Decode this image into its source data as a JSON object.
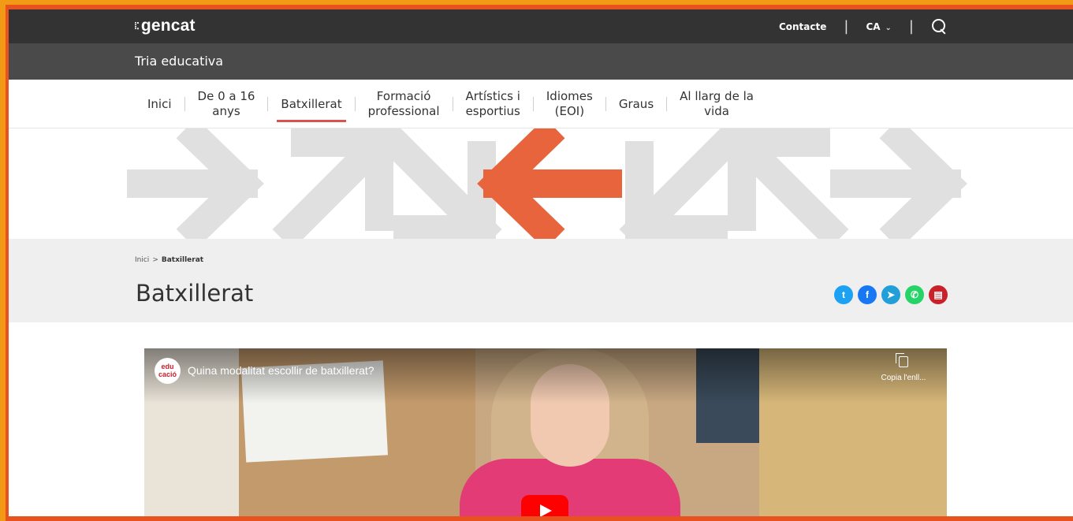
{
  "header": {
    "logo": "gencat",
    "contact": "Contacte",
    "language": "CA",
    "subtitle": "Tria educativa"
  },
  "nav": {
    "items": [
      {
        "line1": "Inici",
        "line2": ""
      },
      {
        "line1": "De 0 a 16",
        "line2": "anys"
      },
      {
        "line1": "Batxillerat",
        "line2": ""
      },
      {
        "line1": "Formació",
        "line2": "professional"
      },
      {
        "line1": "Artístics i",
        "line2": "esportius"
      },
      {
        "line1": "Idiomes",
        "line2": "(EOI)"
      },
      {
        "line1": "Graus",
        "line2": ""
      },
      {
        "line1": "Al llarg de la",
        "line2": "vida"
      }
    ],
    "active_index": 2
  },
  "breadcrumb": {
    "home": "Inici",
    "separator": ">",
    "current": "Batxillerat"
  },
  "page": {
    "title": "Batxillerat"
  },
  "share": [
    {
      "name": "twitter-icon",
      "glyph": "t",
      "color": "#1da1f2"
    },
    {
      "name": "facebook-icon",
      "glyph": "f",
      "color": "#1877f2"
    },
    {
      "name": "telegram-icon",
      "glyph": "➤",
      "color": "#229ed9"
    },
    {
      "name": "whatsapp-icon",
      "glyph": "✆",
      "color": "#25d366"
    },
    {
      "name": "print-icon",
      "glyph": "▤",
      "color": "#c9202a"
    }
  ],
  "video": {
    "channel_line1": "edu",
    "channel_line2": "cació",
    "title": "Quina modalitat escollir de batxillerat?",
    "copy_label": "Copia l'enll..."
  },
  "colors": {
    "accent": "#e8643c",
    "arrow_grey": "#e0e0e0",
    "active_underline": "#d9534f"
  }
}
